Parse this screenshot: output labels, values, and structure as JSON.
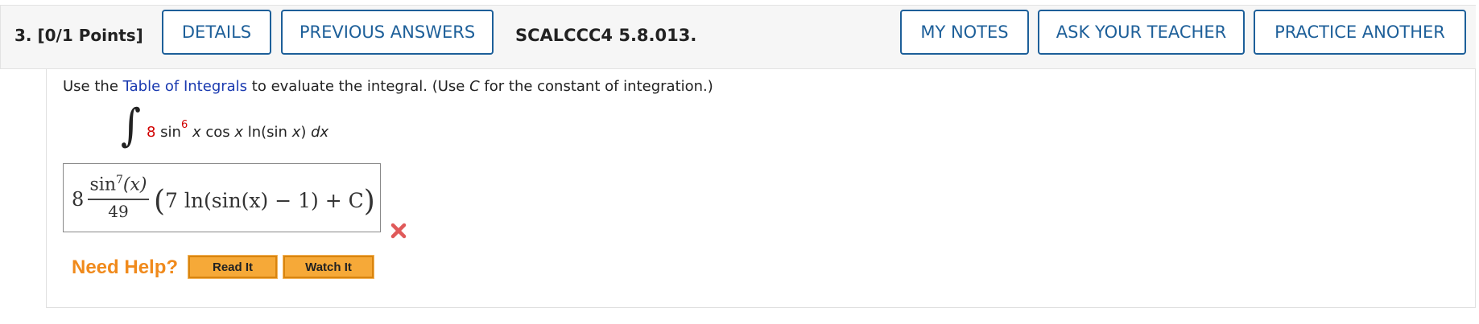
{
  "header": {
    "question_number": "3.",
    "points": "[0/1 Points]",
    "details_label": "DETAILS",
    "previous_answers_label": "PREVIOUS ANSWERS",
    "course_code": "SCALCCC4 5.8.013.",
    "my_notes_label": "MY NOTES",
    "ask_teacher_label": "ASK YOUR TEACHER",
    "practice_another_label": "PRACTICE ANOTHER"
  },
  "prompt": {
    "prefix": "Use the ",
    "link": "Table of Integrals",
    "middle": " to evaluate the integral. (Use ",
    "constant": "C",
    "suffix": " for the constant of integration.)"
  },
  "integral": {
    "sign": "∫",
    "coefficient": "8",
    "func": " sin",
    "power": "6",
    "var1": " x",
    "cos": " cos ",
    "var2": "x",
    "ln": " ln(sin ",
    "var3": "x",
    "close": ") ",
    "dx": "dx"
  },
  "answer": {
    "coefficient": "8",
    "numerator": "sin",
    "numerator_power": "7",
    "numerator_arg": "(x)",
    "denominator": "49",
    "open": "(",
    "body": "7 ln(sin(x) − 1) + C",
    "close": ")",
    "status": "incorrect",
    "status_color": "#e05a5a"
  },
  "help": {
    "label": "Need Help?",
    "read_it": "Read It",
    "watch_it": "Watch It"
  },
  "colors": {
    "accent": "#1d5f99",
    "link": "#1a3ab0",
    "help_orange": "#f08a1c",
    "button_orange": "#f6a938"
  }
}
